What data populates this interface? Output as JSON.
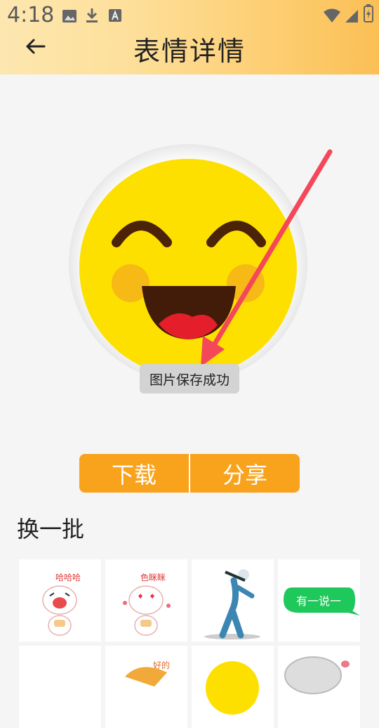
{
  "status_bar": {
    "time": "4:18"
  },
  "header": {
    "title": "表情详情"
  },
  "toast": {
    "text": "图片保存成功"
  },
  "actions": {
    "download_label": "下载",
    "share_label": "分享"
  },
  "section": {
    "title": "换一批"
  },
  "stickers": {
    "items": [
      {
        "caption": "哈哈哈"
      },
      {
        "caption": "色眯眯"
      },
      {
        "caption": ""
      },
      {
        "caption": "有一说一"
      },
      {
        "caption": ""
      },
      {
        "caption": "好的"
      },
      {
        "caption": ""
      },
      {
        "caption": ""
      }
    ]
  },
  "colors": {
    "accent": "#f9a21c",
    "annotation_arrow": "#f5475a",
    "emoji_yellow": "#fde000",
    "bubble_green": "#1ec85a"
  }
}
